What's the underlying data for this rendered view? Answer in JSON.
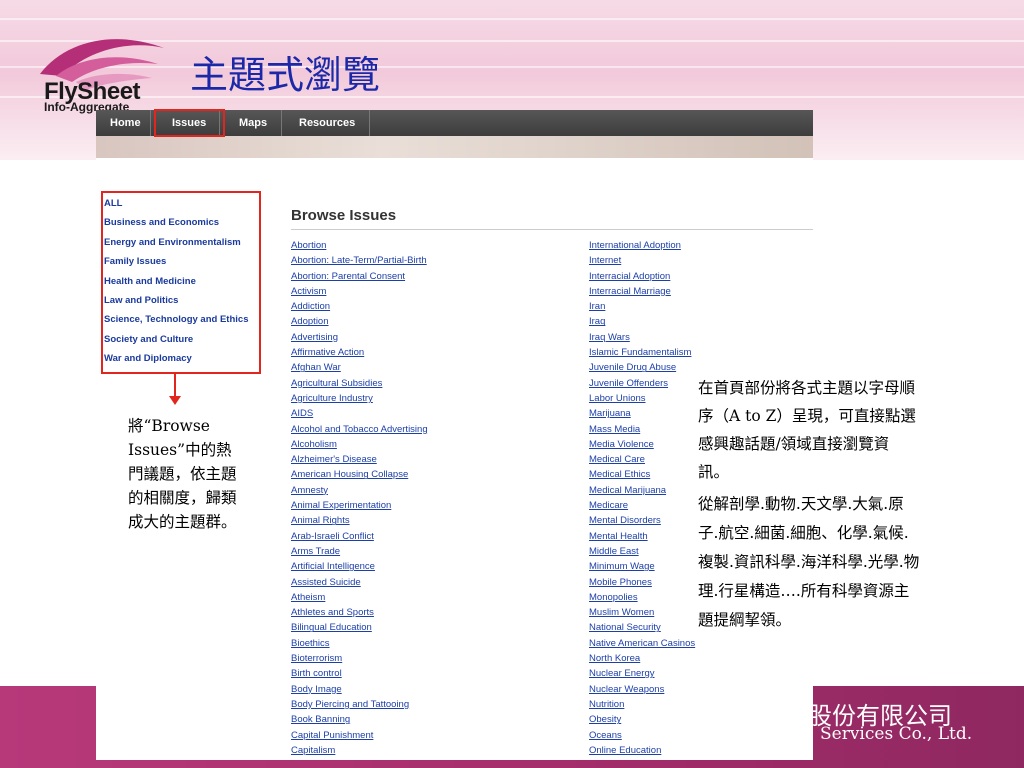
{
  "slide": {
    "title": "主題式瀏覽"
  },
  "logo": {
    "name": "FlySheet",
    "subtitle": "Info-Aggregate"
  },
  "navbar": {
    "items": [
      "Home",
      "Issues",
      "Maps",
      "Resources"
    ]
  },
  "sidebar": {
    "categories": [
      "ALL",
      "Business and Economics",
      "Energy and Environmentalism",
      "Family Issues",
      "Health and Medicine",
      "Law and Politics",
      "Science, Technology and Ethics",
      "Society and Culture",
      "War and Diplomacy"
    ]
  },
  "browse": {
    "heading": "Browse Issues",
    "column1": [
      "Abortion",
      "Abortion: Late-Term/Partial-Birth",
      "Abortion: Parental Consent",
      "Activism",
      "Addiction",
      "Adoption",
      "Advertising",
      "Affirmative Action",
      "Afghan War",
      "Agricultural Subsidies",
      "Agriculture Industry",
      "AIDS",
      "Alcohol and Tobacco Advertising",
      "Alcoholism",
      "Alzheimer's Disease",
      "American Housing Collapse",
      "Amnesty",
      "Animal Experimentation",
      "Animal Rights",
      "Arab-Israeli Conflict",
      "Arms Trade",
      "Artificial Intelligence",
      "Assisted Suicide",
      "Atheism",
      "Athletes and Sports",
      "Bilingual Education",
      "Bioethics",
      "Bioterrorism",
      "Birth control",
      "Body Image",
      "Body Piercing and Tattooing",
      "Book Banning",
      "Capital Punishment",
      "Capitalism"
    ],
    "column2": [
      "International Adoption",
      "Internet",
      "Interracial Adoption",
      "Interracial Marriage",
      "Iran",
      "Iraq",
      "Iraq Wars",
      "Islamic Fundamentalism",
      "Juvenile Drug Abuse",
      "Juvenile Offenders",
      "Labor Unions",
      "Marijuana",
      "Mass Media",
      "Media Violence",
      "Medical Care",
      "Medical Ethics",
      "Medical Marijuana",
      "Medicare",
      "Mental Disorders",
      "Mental Health",
      "Middle East",
      "Minimum Wage",
      "Mobile Phones",
      "Monopolies",
      "Muslim Women",
      "National Security",
      "Native American Casinos",
      "North Korea",
      "Nuclear Energy",
      "Nuclear Weapons",
      "Nutrition",
      "Obesity",
      "Oceans",
      "Online Education"
    ]
  },
  "annotations": {
    "left_note": "將“Browse Issues”中的熱門議題，依主題的相關度，歸類成大的主題群。",
    "right_para1": "在首頁部份將各式主題以字母順序（A to Z）呈現，可直接點選感興趣話題/領域直接瀏覽資訊。",
    "right_para2": "從解剖學.動物.天文學.大氣.原子.航空.細菌.細胞、化學.氣候.複製.資訊科學.海洋科學.光學.物理.行星構造….所有科學資源主題提綱挈領。"
  },
  "footer": {
    "company_cn": "股份有限公司",
    "company_en": "Services Co., Ltd."
  },
  "colors": {
    "title": "#1b28a8",
    "link": "#1c3fa8",
    "highlight_box": "#e0261e",
    "footer": "#a22c6a"
  }
}
